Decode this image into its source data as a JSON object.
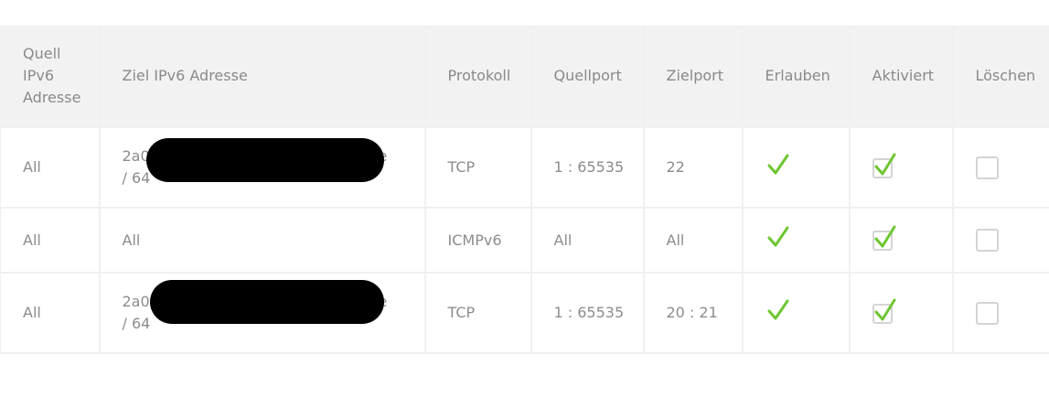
{
  "colors": {
    "check": "#6ec531",
    "header_bg": "#f2f2f2",
    "text": "#8c8c8c",
    "redaction": "#000000"
  },
  "table": {
    "headers": [
      "Quell IPv6 Adresse",
      "Ziel IPv6 Adresse",
      "Protokoll",
      "Quellport",
      "Zielport",
      "Erlauben",
      "Aktiviert",
      "Löschen"
    ],
    "rows": [
      {
        "source": "All",
        "dest_line1_prefix": "2a0",
        "dest_line1_suffix": "ee",
        "dest_line2": "/ 64",
        "protocol": "TCP",
        "source_port": "1 : 65535",
        "dest_port": "22",
        "allow": true,
        "enabled": true,
        "delete": false
      },
      {
        "source": "All",
        "dest": "All",
        "protocol": "ICMPv6",
        "source_port": "All",
        "dest_port": "All",
        "allow": true,
        "enabled": true,
        "delete": false
      },
      {
        "source": "All",
        "dest_line1_prefix": "2a0",
        "dest_line1_suffix": "ee",
        "dest_line2": "/ 64",
        "protocol": "TCP",
        "source_port": "1 : 65535",
        "dest_port": "20 : 21",
        "allow": true,
        "enabled": true,
        "delete": false
      }
    ]
  }
}
